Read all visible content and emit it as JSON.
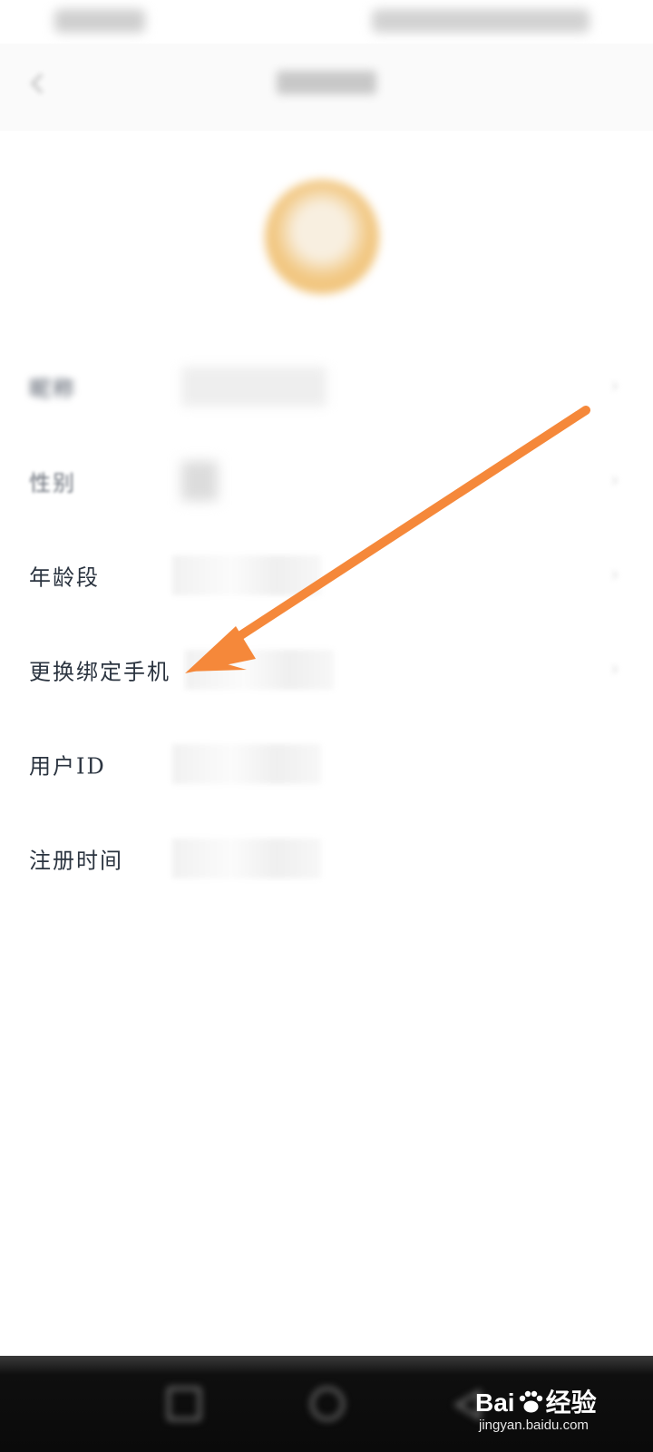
{
  "profile_rows": [
    {
      "label": "昵称"
    },
    {
      "label": "性别"
    },
    {
      "label": "年龄段"
    },
    {
      "label": "更换绑定手机"
    },
    {
      "label": "用户ID"
    },
    {
      "label": "注册时间"
    }
  ],
  "colors": {
    "annotation_arrow": "#f5883a",
    "label_text": "#2b3440",
    "nav_bar": "#0a0a0a"
  },
  "icons": {
    "back": "back-arrow-icon",
    "chevron": "chevron-right-icon",
    "nav_recent": "recent-apps-icon",
    "nav_home": "home-icon",
    "nav_back": "back-triangle-icon"
  },
  "watermark": {
    "brand": "Bai",
    "brand_suffix": "经验",
    "url": "jingyan.baidu.com"
  }
}
